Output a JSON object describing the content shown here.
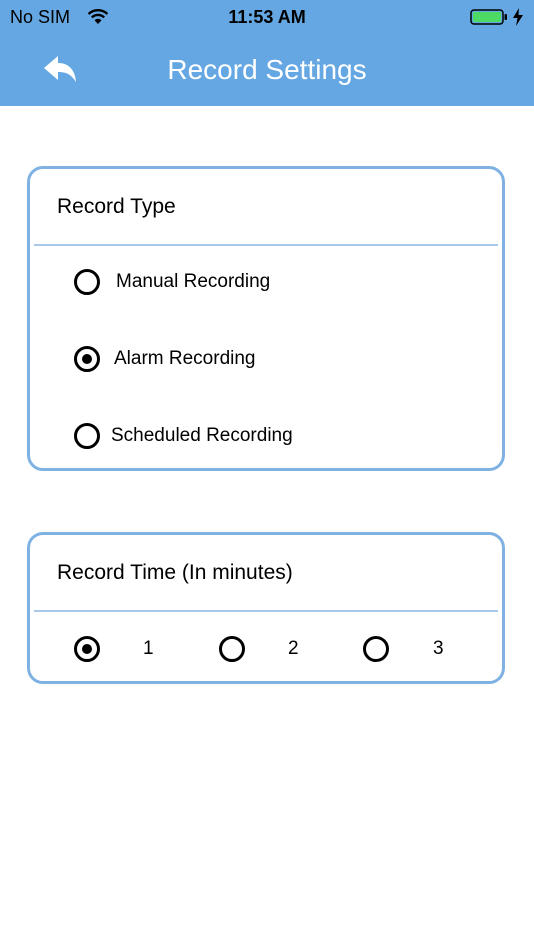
{
  "status_bar": {
    "carrier": "No SIM",
    "time": "11:53 AM",
    "battery_color": "#4cd964"
  },
  "header": {
    "title": "Record Settings",
    "background": "#64a7e2",
    "back_icon": "reply-arrow-icon"
  },
  "record_type": {
    "title": "Record Type",
    "options": [
      {
        "label": "Manual Recording",
        "selected": false
      },
      {
        "label": "Alarm Recording",
        "selected": true
      },
      {
        "label": "Scheduled Recording",
        "selected": false
      }
    ]
  },
  "record_time": {
    "title": "Record Time (In minutes)",
    "options": [
      {
        "label": "1",
        "selected": true
      },
      {
        "label": "2",
        "selected": false
      },
      {
        "label": "3",
        "selected": false
      }
    ]
  },
  "colors": {
    "card_border": "#7fb2e3",
    "divider": "#a9c9ea"
  }
}
